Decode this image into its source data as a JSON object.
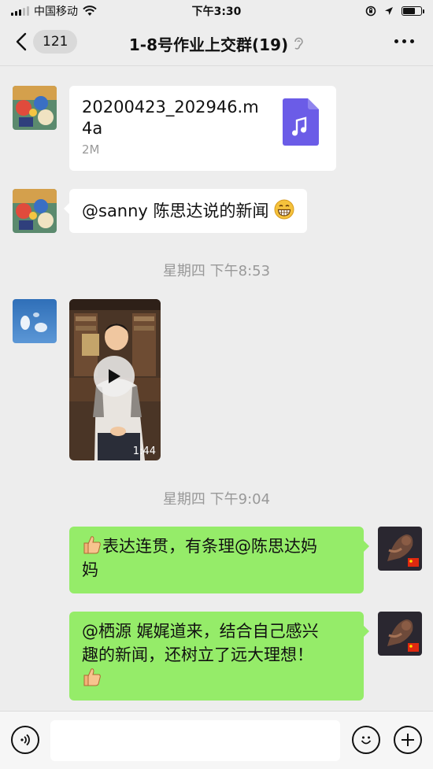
{
  "status_bar": {
    "carrier": "中国移动",
    "time": "下午3:30",
    "battery_level": 0.7
  },
  "header": {
    "unread_count": "121",
    "title": "1-8号作业上交群(19)"
  },
  "messages": [
    {
      "type": "file",
      "side": "left",
      "file_name": "20200423_202946.m4a",
      "file_name_line1": "20200423_202946.m",
      "file_name_line2": "4a",
      "file_size": "2M"
    },
    {
      "type": "text",
      "side": "left",
      "text": "@sanny 陈思达说的新闻",
      "trailing_emoji": "grinning-face-icon"
    },
    {
      "type": "time",
      "text": "星期四 下午8:53"
    },
    {
      "type": "video",
      "side": "left",
      "duration": "1:44"
    },
    {
      "type": "time",
      "text": "星期四 下午9:04"
    },
    {
      "type": "text",
      "side": "right",
      "line1": "表达连贯，有条理@陈思达妈",
      "line2": "妈",
      "leading_emoji": "thumbs-up-icon"
    },
    {
      "type": "text",
      "side": "right",
      "line1": "@栖源 娓娓道来，结合自己感兴",
      "line2": "趣的新闻，还树立了远大理想！",
      "trailing_emoji": "thumbs-up-icon"
    }
  ],
  "colors": {
    "sent_bubble": "#95ec69",
    "received_bubble": "#ffffff",
    "background": "#ededed",
    "file_icon": "#6b5ce7"
  }
}
